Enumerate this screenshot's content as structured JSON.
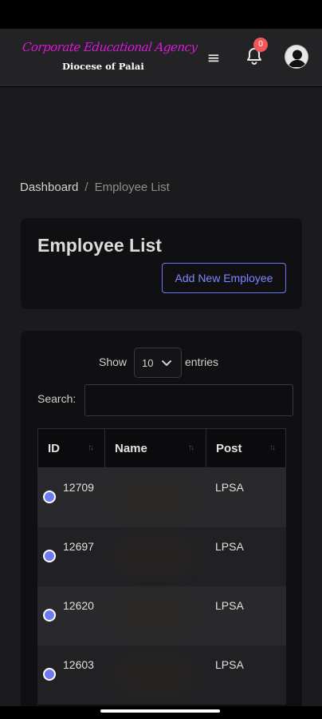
{
  "header": {
    "logo_line1": "Corporate Educational Agency",
    "logo_line2": "Diocese of Palai",
    "notification_count": "0",
    "icons": {
      "menu": "menu-icon",
      "notifications": "bell-icon",
      "profile": "user-avatar-icon"
    }
  },
  "breadcrumb": {
    "home": "Dashboard",
    "separator": "/",
    "current": "Employee List"
  },
  "page": {
    "title": "Employee List",
    "add_button": "Add New Employee"
  },
  "table_controls": {
    "show_label": "Show",
    "page_length": "10",
    "entries_label": "entries",
    "search_label": "Search:",
    "search_value": ""
  },
  "table": {
    "columns": [
      "ID",
      "Name",
      "Post"
    ],
    "rows": [
      {
        "id": "12709",
        "name": "",
        "post": "LPSA"
      },
      {
        "id": "12697",
        "name": "",
        "post": "LPSA"
      },
      {
        "id": "12620",
        "name": "",
        "post": "LPSA"
      },
      {
        "id": "12603",
        "name": "",
        "post": "LPSA"
      }
    ]
  },
  "colors": {
    "accent": "#6f78f5",
    "badge": "#f0565a",
    "logo": "#d81ad8",
    "card": "#101012",
    "background": "#1b1b1d"
  }
}
